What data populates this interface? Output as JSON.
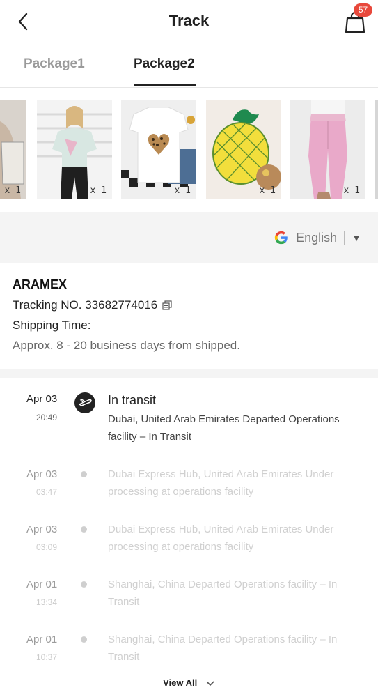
{
  "header": {
    "title": "Track",
    "cart_count": "57"
  },
  "tabs": [
    {
      "label": "Package1",
      "active": false
    },
    {
      "label": "Package2",
      "active": true
    }
  ],
  "products": [
    {
      "qty": "x 1"
    },
    {
      "qty": "x 1"
    },
    {
      "qty": "x 1"
    },
    {
      "qty": "x 1"
    },
    {
      "qty": "x 1"
    }
  ],
  "language": {
    "label": "English",
    "arrow": "▼"
  },
  "carrier": {
    "name": "ARAMEX",
    "tracking_label": "Tracking NO. 33682774016",
    "shipping_time_label": "Shipping Time:",
    "shipping_time_value": "Approx. 8 - 20 business days from shipped."
  },
  "timeline": [
    {
      "date": "Apr 03",
      "time": "20:49",
      "status": "In transit",
      "detail": "Dubai, United Arab Emirates Departed Operations facility – In Transit"
    },
    {
      "date": "Apr 03",
      "time": "03:47",
      "detail": "Dubai Express Hub, United Arab Emirates Under processing at operations facility"
    },
    {
      "date": "Apr 03",
      "time": "03:09",
      "detail": "Dubai Express Hub, United Arab Emirates Under processing at operations facility"
    },
    {
      "date": "Apr 01",
      "time": "13:34",
      "detail": "Shanghai, China Departed Operations facility – In Transit"
    },
    {
      "date": "Apr 01",
      "time": "10:37",
      "detail": "Shanghai, China Departed Operations facility – In Transit"
    }
  ],
  "view_all_label": "View All",
  "colors": {
    "badge": "#e8483b",
    "active_text": "#222222",
    "inactive_text": "#9a9a9a",
    "band": "#f4f4f4"
  }
}
